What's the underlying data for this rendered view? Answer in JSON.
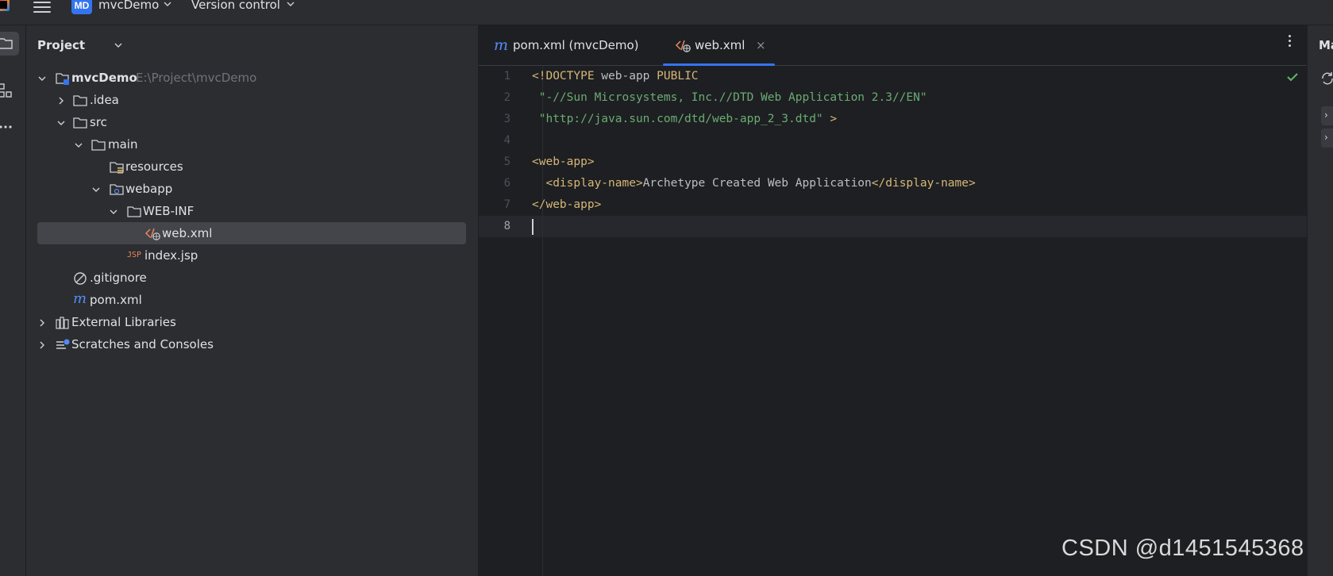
{
  "titlebar": {
    "project_badge": "MD",
    "project_name": "mvcDemo",
    "vcs_label": "Version control"
  },
  "project_panel": {
    "title": "Project",
    "tree": [
      {
        "label": "mvcDemo",
        "hint": "E:\\Project\\mvcDemo",
        "icon": "module-folder-icon",
        "expanded": true
      },
      {
        "label": ".idea",
        "icon": "folder-icon",
        "expanded": false
      },
      {
        "label": "src",
        "icon": "folder-icon",
        "expanded": true
      },
      {
        "label": "main",
        "icon": "folder-icon",
        "expanded": true
      },
      {
        "label": "resources",
        "icon": "resources-folder-icon"
      },
      {
        "label": "webapp",
        "icon": "web-folder-icon",
        "expanded": true
      },
      {
        "label": "WEB-INF",
        "icon": "folder-icon",
        "expanded": true
      },
      {
        "label": "web.xml",
        "icon": "xml-web-icon",
        "selected": true
      },
      {
        "label": "index.jsp",
        "icon": "jsp-icon"
      },
      {
        "label": ".gitignore",
        "icon": "gitignore-icon"
      },
      {
        "label": "pom.xml",
        "icon": "maven-icon"
      },
      {
        "label": "External Libraries",
        "icon": "library-icon",
        "expanded": false
      },
      {
        "label": "Scratches and Consoles",
        "icon": "scratches-icon",
        "expanded": false
      }
    ]
  },
  "editor": {
    "tabs": [
      {
        "label": "pom.xml (mvcDemo)",
        "icon": "maven-icon",
        "active": false
      },
      {
        "label": "web.xml",
        "icon": "xml-web-icon",
        "active": true,
        "close": "×"
      }
    ],
    "line_numbers": [
      "1",
      "2",
      "3",
      "4",
      "5",
      "6",
      "7",
      "8"
    ],
    "current_line": 8,
    "code": {
      "l1_a": "<!DOCTYPE",
      "l1_b": " web-app ",
      "l1_c": "PUBLIC",
      "l2": " \"-//Sun Microsystems, Inc.//DTD Web Application 2.3//EN\"",
      "l3_a": " \"http://java.sun.com/dtd/web-app_2_3.dtd\"",
      "l3_b": " >",
      "l5": "<web-app>",
      "l6_a": "  <display-name>",
      "l6_b": "Archetype Created Web Application",
      "l6_c": "</display-name>",
      "l7": "</web-app>"
    },
    "inspection_status": "ok"
  },
  "right_panel": {
    "title": "Ma"
  },
  "watermark": "CSDN @d1451545368",
  "colors": {
    "accent": "#3574f0",
    "tag": "#d5b778",
    "string": "#6aab73",
    "ok": "#5fb865"
  }
}
